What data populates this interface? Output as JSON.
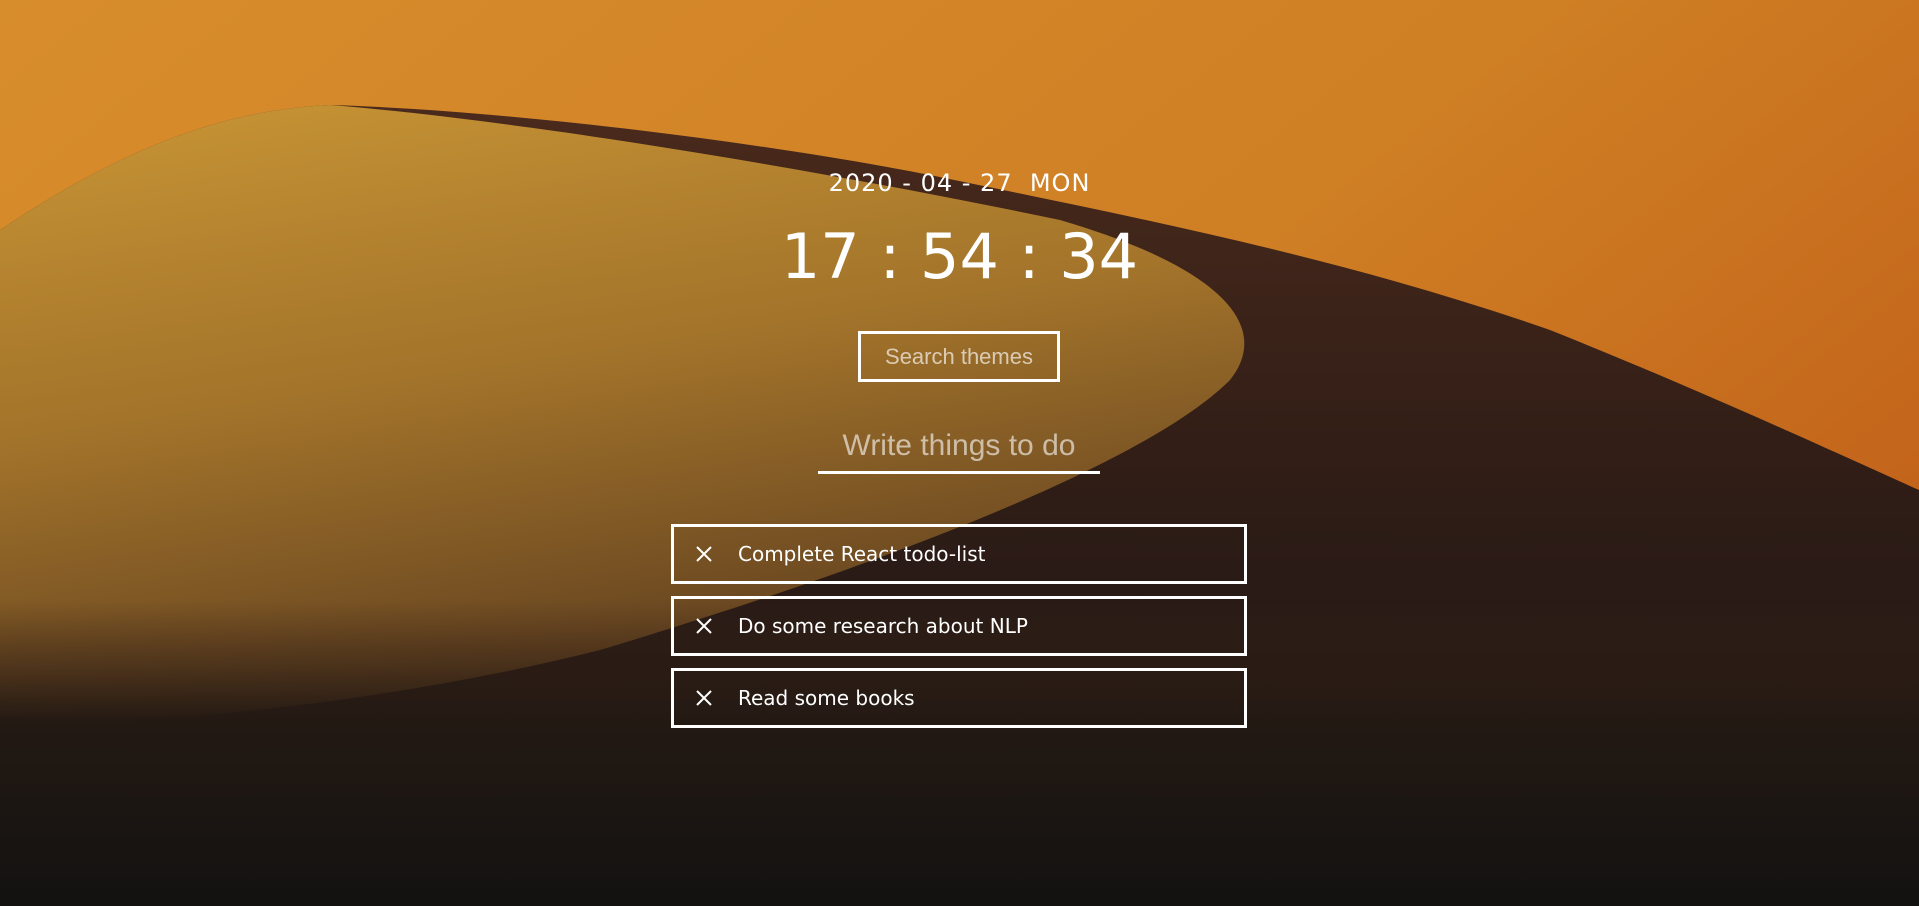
{
  "clock": {
    "date": "2020 - 04 - 27  MON",
    "time": "17 : 54 : 34"
  },
  "search": {
    "placeholder": "Search themes"
  },
  "todo_input": {
    "placeholder": "Write things to do"
  },
  "todos": [
    {
      "text": "Complete React todo-list",
      "delete_icon": "close-icon"
    },
    {
      "text": "Do some research about NLP",
      "delete_icon": "close-icon"
    },
    {
      "text": "Read some books",
      "delete_icon": "close-icon"
    }
  ],
  "colors": {
    "foreground": "#ffffff",
    "sky": "#d4892b",
    "dune_light": "#c58a2e",
    "dune_shadow": "#2a1c16",
    "ground_dark": "#151312"
  }
}
